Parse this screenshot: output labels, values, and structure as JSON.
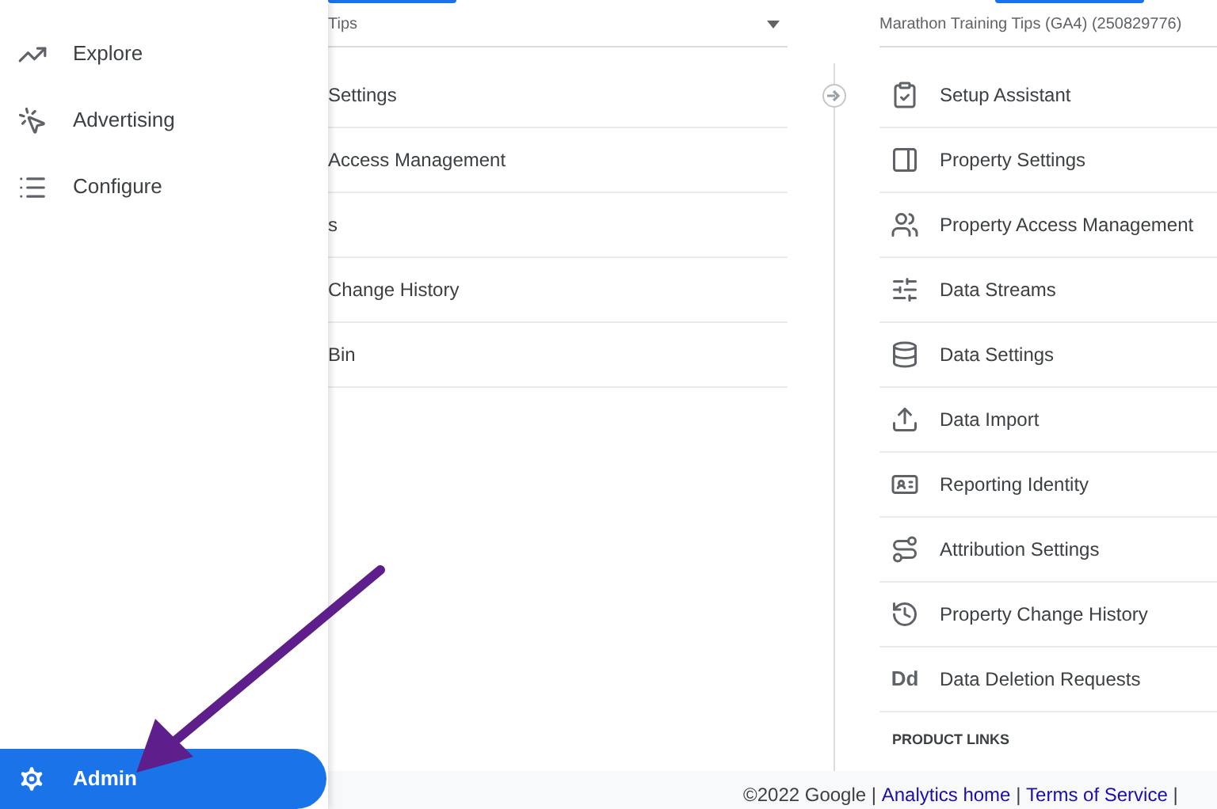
{
  "sidebar": {
    "items": [
      {
        "label": "Explore",
        "selected": false
      },
      {
        "label": "Advertising",
        "selected": false
      },
      {
        "label": "Configure",
        "selected": false
      }
    ],
    "admin": {
      "label": "Admin",
      "selected": true
    }
  },
  "account_column": {
    "selector": "Tips",
    "items": [
      "Settings",
      "Access Management",
      "s",
      "Change History",
      "Bin"
    ]
  },
  "property_column": {
    "selector": "Marathon Training Tips (GA4) (250829776)",
    "items": [
      {
        "label": "Setup Assistant"
      },
      {
        "label": "Property Settings"
      },
      {
        "label": "Property Access Management"
      },
      {
        "label": "Data Streams"
      },
      {
        "label": "Data Settings"
      },
      {
        "label": "Data Import"
      },
      {
        "label": "Reporting Identity"
      },
      {
        "label": "Attribution Settings"
      },
      {
        "label": "Property Change History"
      },
      {
        "label": "Data Deletion Requests",
        "icon_text": "Dd"
      }
    ],
    "section": "PRODUCT LINKS"
  },
  "footer": [
    {
      "kind": "text",
      "text": "©2022 Google | "
    },
    {
      "kind": "link",
      "text": "Analytics home"
    },
    {
      "kind": "text",
      "text": " | "
    },
    {
      "kind": "link",
      "text": "Terms of Service"
    },
    {
      "kind": "text",
      "text": " |"
    }
  ]
}
